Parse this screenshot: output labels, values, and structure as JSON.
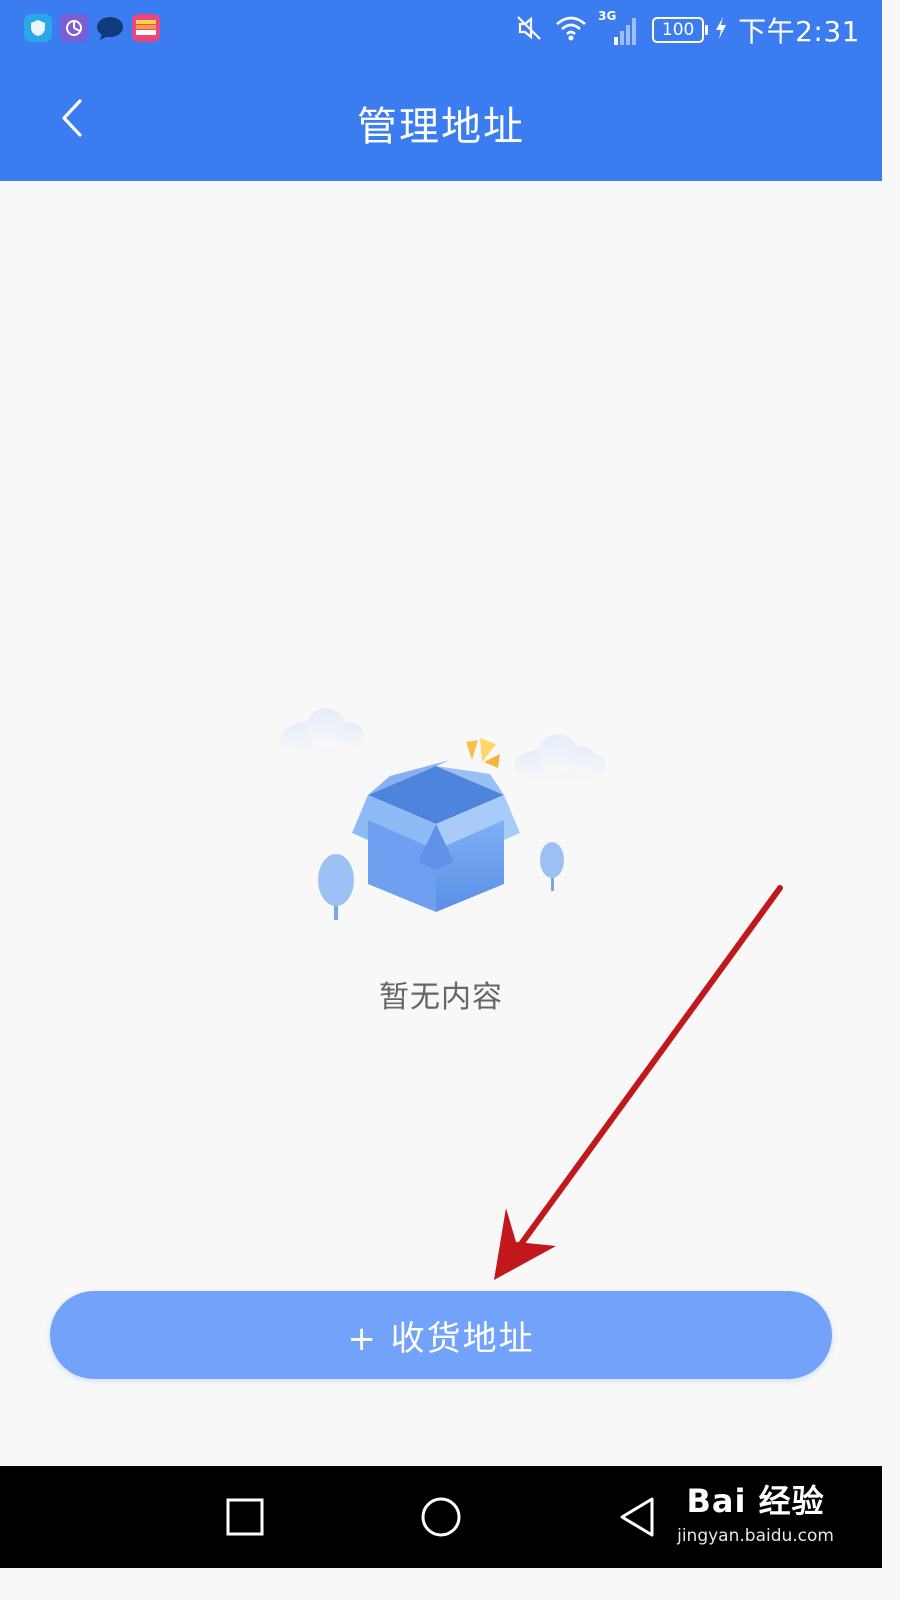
{
  "status_bar": {
    "network": "3G",
    "battery": "100",
    "time": "下午2:31",
    "notification_icons": [
      "shield-app-icon",
      "pie-app-icon",
      "chat-app-icon",
      "wallet-app-icon"
    ]
  },
  "header": {
    "title": "管理地址",
    "back_icon": "chevron-left-icon"
  },
  "empty_state": {
    "message": "暂无内容",
    "illustration": "open-box-icon"
  },
  "add_address_button": {
    "label": "+ 收货地址"
  },
  "annotation": {
    "arrow_color": "#c0181b"
  },
  "watermark": {
    "logo": "Bai 经验",
    "url": "jingyan.baidu.com"
  },
  "colors": {
    "header": "#3b7cf0",
    "button": "#73a2fb",
    "background": "#f8f8f9"
  }
}
